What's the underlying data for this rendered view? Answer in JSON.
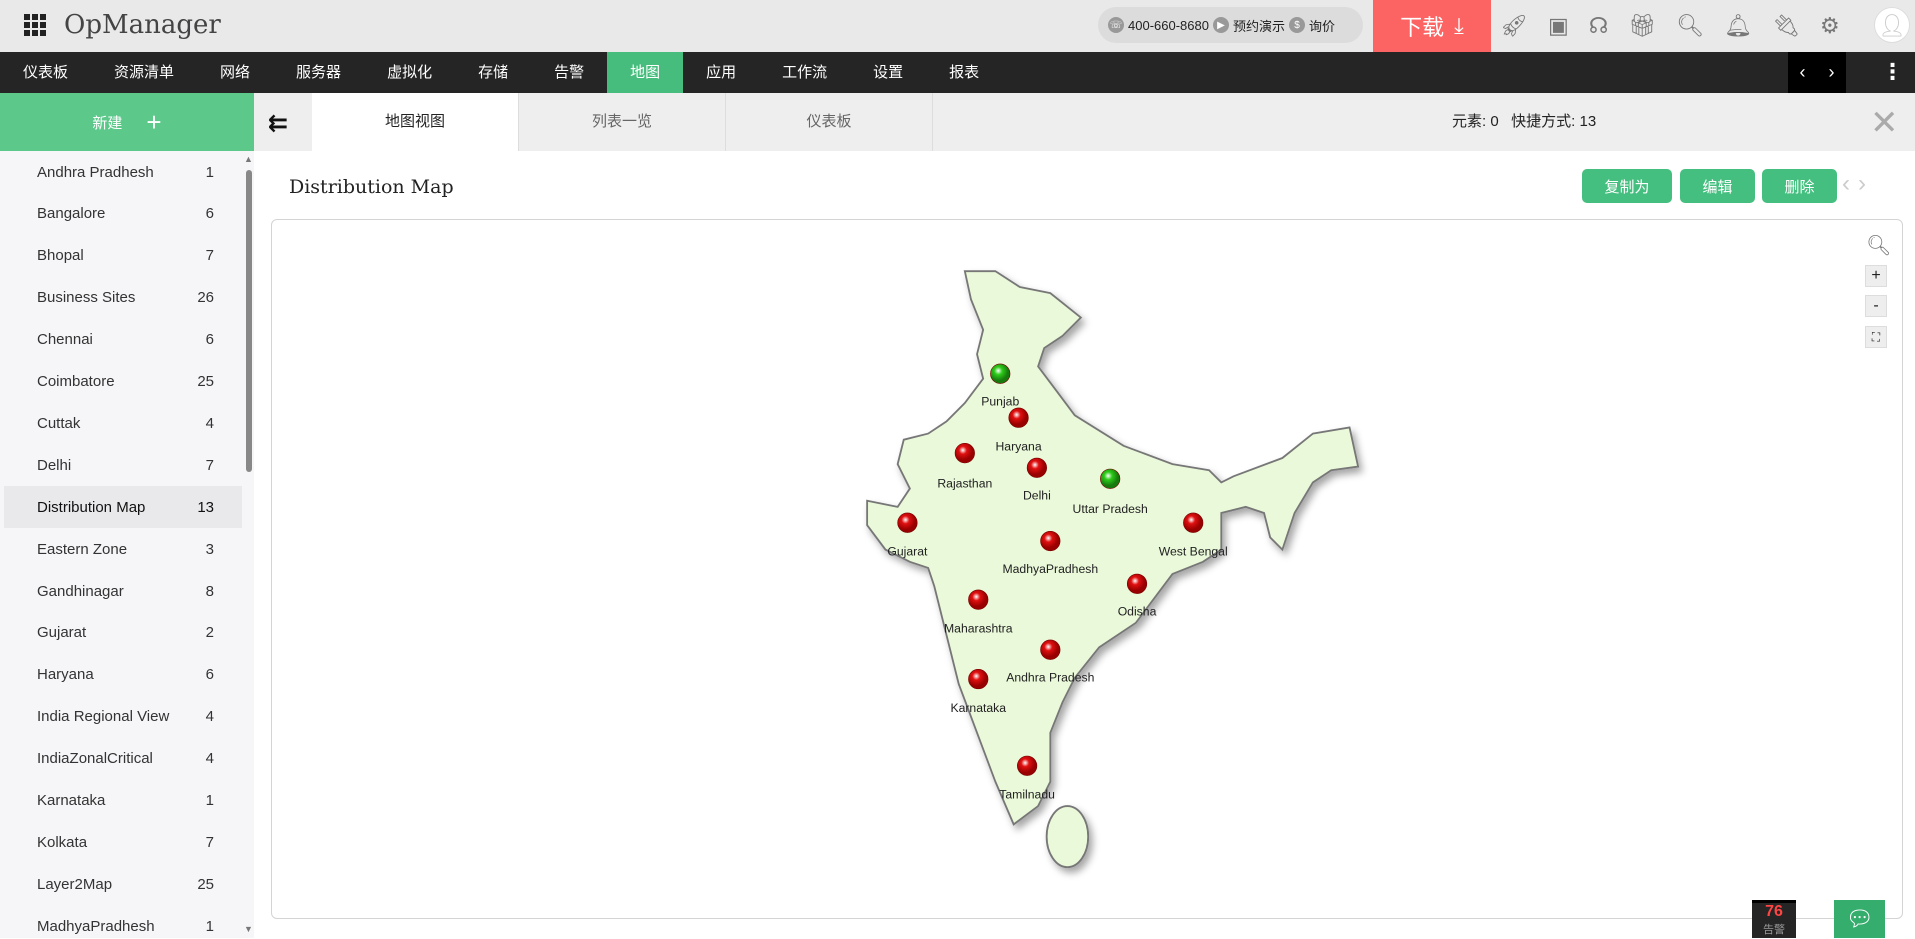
{
  "header": {
    "app_title": "OpManager",
    "phone": "400-660-8680",
    "demo": "预约演示",
    "price": "询价",
    "download": "下载"
  },
  "nav": {
    "items": [
      "仪表板",
      "资源清单",
      "网络",
      "服务器",
      "虚拟化",
      "存储",
      "告警",
      "地图",
      "应用",
      "工作流",
      "设置",
      "报表"
    ],
    "active": "地图"
  },
  "sidebar": {
    "new_label": "新建",
    "items": [
      {
        "name": "Andhra Pradhesh",
        "count": "1"
      },
      {
        "name": "Bangalore",
        "count": "6"
      },
      {
        "name": "Bhopal",
        "count": "7"
      },
      {
        "name": "Business Sites",
        "count": "26"
      },
      {
        "name": "Chennai",
        "count": "6"
      },
      {
        "name": "Coimbatore",
        "count": "25"
      },
      {
        "name": "Cuttak",
        "count": "4"
      },
      {
        "name": "Delhi",
        "count": "7"
      },
      {
        "name": "Distribution Map",
        "count": "13"
      },
      {
        "name": "Eastern Zone",
        "count": "3"
      },
      {
        "name": "Gandhinagar",
        "count": "8"
      },
      {
        "name": "Gujarat",
        "count": "2"
      },
      {
        "name": "Haryana",
        "count": "6"
      },
      {
        "name": "India Regional View",
        "count": "4"
      },
      {
        "name": "IndiaZonalCritical",
        "count": "4"
      },
      {
        "name": "Karnataka",
        "count": "1"
      },
      {
        "name": "Kolkata",
        "count": "7"
      },
      {
        "name": "Layer2Map",
        "count": "25"
      },
      {
        "name": "MadhyaPradhesh",
        "count": "1"
      }
    ],
    "selected": "Distribution Map"
  },
  "tabs": {
    "items": [
      "地图视图",
      "列表一览",
      "仪表板"
    ],
    "active": "地图视图",
    "info": "元素: 0   快捷方式: 13"
  },
  "main": {
    "title": "Distribution Map",
    "copy": "复制为",
    "edit": "编辑",
    "delete": "删除",
    "markers": [
      {
        "label": "Punjab",
        "status": "up"
      },
      {
        "label": "Haryana",
        "status": "down"
      },
      {
        "label": "Rajasthan",
        "status": "down"
      },
      {
        "label": "Delhi",
        "status": "down"
      },
      {
        "label": "Uttar Pradesh",
        "status": "up"
      },
      {
        "label": "Gujarat",
        "status": "down"
      },
      {
        "label": "West Bengal",
        "status": "down"
      },
      {
        "label": "MadhyaPradhesh",
        "status": "down"
      },
      {
        "label": "Odisha",
        "status": "down"
      },
      {
        "label": "Maharashtra",
        "status": "down"
      },
      {
        "label": "Andhra Pradesh",
        "status": "down"
      },
      {
        "label": "Karnataka",
        "status": "down"
      },
      {
        "label": "Tamilnadu",
        "status": "down"
      }
    ]
  },
  "colors": {
    "accent": "#46bd7d",
    "download": "#fc6464",
    "up": "#2ecc1a",
    "down": "#e01010",
    "map_fill": "#eaf9d9"
  },
  "footer": {
    "alarm_count": "76",
    "alarm_label": "告警"
  }
}
